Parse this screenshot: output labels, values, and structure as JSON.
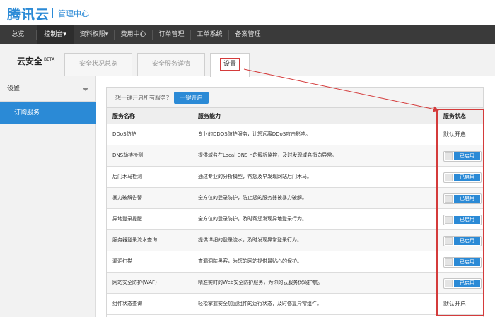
{
  "brand": {
    "logo": "腾讯云",
    "subtitle": "管理中心"
  },
  "nav": [
    {
      "label": "总览"
    },
    {
      "label": "控制台▾"
    },
    {
      "label": "资料权限▾"
    },
    {
      "label": "费用中心"
    },
    {
      "label": "订单管理"
    },
    {
      "label": "工单系统"
    },
    {
      "label": "备案管理"
    }
  ],
  "page": {
    "title": "云安全",
    "beta": "BETA"
  },
  "tabs": [
    {
      "label": "安全状况总览"
    },
    {
      "label": "安全服务详情"
    },
    {
      "label": "设置"
    }
  ],
  "sidebar": {
    "header": "设置",
    "active_item": "订购服务"
  },
  "toolbar": {
    "prompt": "想一键开启所有服务？",
    "button": "一键开启"
  },
  "table": {
    "headers": [
      "服务名称",
      "服务能力",
      "服务状态"
    ],
    "rows": [
      {
        "name": "DDoS防护",
        "capability": "专业的DDOS防护服务，让您远离DDoS攻击影响。",
        "status": "默认开启",
        "toggle": false
      },
      {
        "name": "DNS劫持检测",
        "capability": "提供域名在Local DNS上的解析监控，及时发现域名指向异常。",
        "status": "已启用",
        "toggle": true
      },
      {
        "name": "后门木马检测",
        "capability": "通过专业的分析模型，帮您及早发现网站后门木马。",
        "status": "已启用",
        "toggle": true
      },
      {
        "name": "暴力破解告警",
        "capability": "全方位的登录防护，防止您的服务器被暴力破解。",
        "status": "已启用",
        "toggle": true
      },
      {
        "name": "异地登录提醒",
        "capability": "全方位的登录防护，及时帮您发现异地登录行为。",
        "status": "已启用",
        "toggle": true
      },
      {
        "name": "服务器登录流水查询",
        "capability": "提供详细的登录流水，及时发现异常登录行为。",
        "status": "已启用",
        "toggle": true
      },
      {
        "name": "漏洞扫描",
        "capability": "查漏洞防黑客，为您的网站提供最贴心的保护。",
        "status": "已启用",
        "toggle": true
      },
      {
        "name": "网站安全防护(WAF)",
        "capability": "精准实时的Web安全防护服务，为你的云服务保驾护航。",
        "status": "已启用",
        "toggle": true
      },
      {
        "name": "组件状态查询",
        "capability": "轻松掌握安全加固组件的运行状态，及时修复异常组件。",
        "status": "默认开启",
        "toggle": false
      }
    ]
  },
  "colors": {
    "accent": "#2b8ad6",
    "annotation": "#d43b3b",
    "navbar": "#3a3a3a"
  }
}
